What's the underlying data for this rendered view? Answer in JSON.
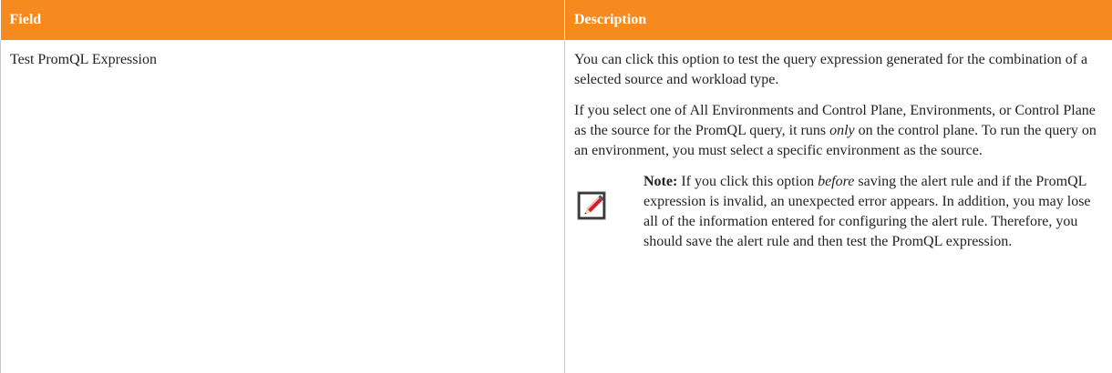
{
  "table": {
    "headers": {
      "field": "Field",
      "description": "Description"
    },
    "row": {
      "field": "Test PromQL Expression",
      "description": {
        "para1": "You can click this option to test the query expression generated for the combination of a selected source and workload type.",
        "para2_before": "If you select one of All Environments and Control Plane, Environments, or Control Plane as the source for the PromQL query, it runs ",
        "para2_emph": "only",
        "para2_after": " on the control plane. To run the query on an environment, you must select a specific environment as the source.",
        "note": {
          "label": "Note:",
          "text_before": "  If you click this option ",
          "text_emph": "before",
          "text_after": " saving the alert rule and if the PromQL expression is invalid, an unexpected error appears. In addition, you may lose all of the information entered for configuring the alert rule. Therefore, you should save the alert rule and then test the PromQL expression."
        }
      }
    }
  },
  "colors": {
    "header_bg": "#f68a1e",
    "header_text": "#ffffff",
    "border": "#c9c9c9",
    "note_icon_accent": "#d0202e"
  },
  "icons": {
    "note": "note-pencil-icon"
  }
}
